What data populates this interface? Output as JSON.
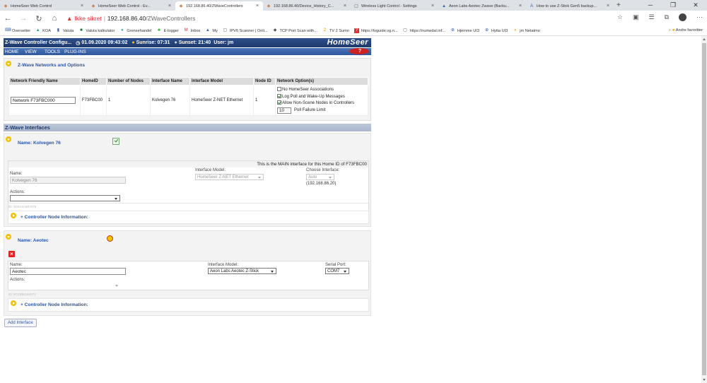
{
  "browser": {
    "tabs": [
      {
        "title": "HomeSeer Web Control",
        "active": false
      },
      {
        "title": "HomeSeer Web Control - Ev...",
        "active": false
      },
      {
        "title": "192.168.86.40/ZWaveControllers",
        "active": true
      },
      {
        "title": "192.168.86.40/Device_History_C...",
        "active": false
      },
      {
        "title": "Wireless Light Control - Settings",
        "active": false
      },
      {
        "title": "Aeon Labs Aeotec Zwave (Backu...",
        "active": false
      },
      {
        "title": "How to use Z-Stick Gen5 backup...",
        "active": false
      }
    ],
    "security": "Ikke sikret",
    "host": "192.168.86.40",
    "path": "/ZWaveControllers",
    "bookmarks": [
      "Oversetter",
      "KOA",
      "Valuta",
      "Valuta kalkulator",
      "Grensehandel",
      "E-logger",
      "Inbox",
      "My",
      "IPV6 Scanner | Onli...",
      "TCP Port Scan with...",
      "TV 2 Sumo",
      "https://tvguide.vg.n...",
      "https://numedal.inf...",
      "Hjemme UI3",
      "Hytta UI3",
      "jm Netatmo"
    ],
    "other_bookmarks": "Andre favoritter"
  },
  "header": {
    "title": "Z-Wave Controller Configu...",
    "datetime": "01.09.2020 09:43:02",
    "sunrise": "Sunrise: 07:31",
    "sunset": "Sunset: 21:40",
    "user": "User: jm",
    "logo": "HomeSeer"
  },
  "menu": [
    "HOME",
    "VIEW",
    "TOOLS",
    "PLUG-INS"
  ],
  "networks": {
    "title": "Z-Wave Networks and Options",
    "columns": [
      "Network Friendly Name",
      "HomeID",
      "Number of Nodes",
      "Interface Name",
      "Interface Model",
      "Node ID",
      "Network Option(s)"
    ],
    "row": {
      "name": "Network F73FBC000",
      "homeid": "F73FBC00",
      "nodes": "1",
      "iface_name": "Kolvegen 76",
      "iface_model": "HomeSeer Z-NET Ethernet",
      "node_id": "1",
      "options": [
        {
          "label": "No HomeSeer Associations",
          "checked": false
        },
        {
          "label": "Log Poll and Wake-Up Messages",
          "checked": true
        },
        {
          "label": "Allow Non-Scene Nodes in Controllers",
          "checked": true
        }
      ],
      "poll_failure_value": "10",
      "poll_failure_label": "Poll Failure Limit"
    }
  },
  "interfaces_title": "Z-Wave Interfaces",
  "iface1": {
    "name_heading": "Name: Kolvegen 76",
    "main_note": "This is the MAIN interface for this Home ID of F73FBC00",
    "name_label": "Name:",
    "name_value": "Kolvegen 76",
    "model_label": "Interface Model:",
    "model_value": "HomeSeer Z-NET Ethernet",
    "choose_label": "Choose Interface:",
    "choose_value": "Auto",
    "ip": "(192.168.86.20)",
    "actions_label": "Actions:",
    "id_text": "ID: 3D0A4A5B7078",
    "node_info": "+ Controller Node Information:"
  },
  "iface2": {
    "name_heading": "Name: Aeotec",
    "name_label": "Name:",
    "name_value": "Aeotec",
    "model_label": "Interface Model:",
    "model_value": "Aeon Labs Aeotec Z-Stick",
    "serial_label": "Serial Port:",
    "serial_value": "COM7",
    "actions_label": "Actions:",
    "id_text": "ID: 9CC8B1146272",
    "node_info": "+ Controller Node Information:"
  },
  "add_interface": "Add Interface"
}
